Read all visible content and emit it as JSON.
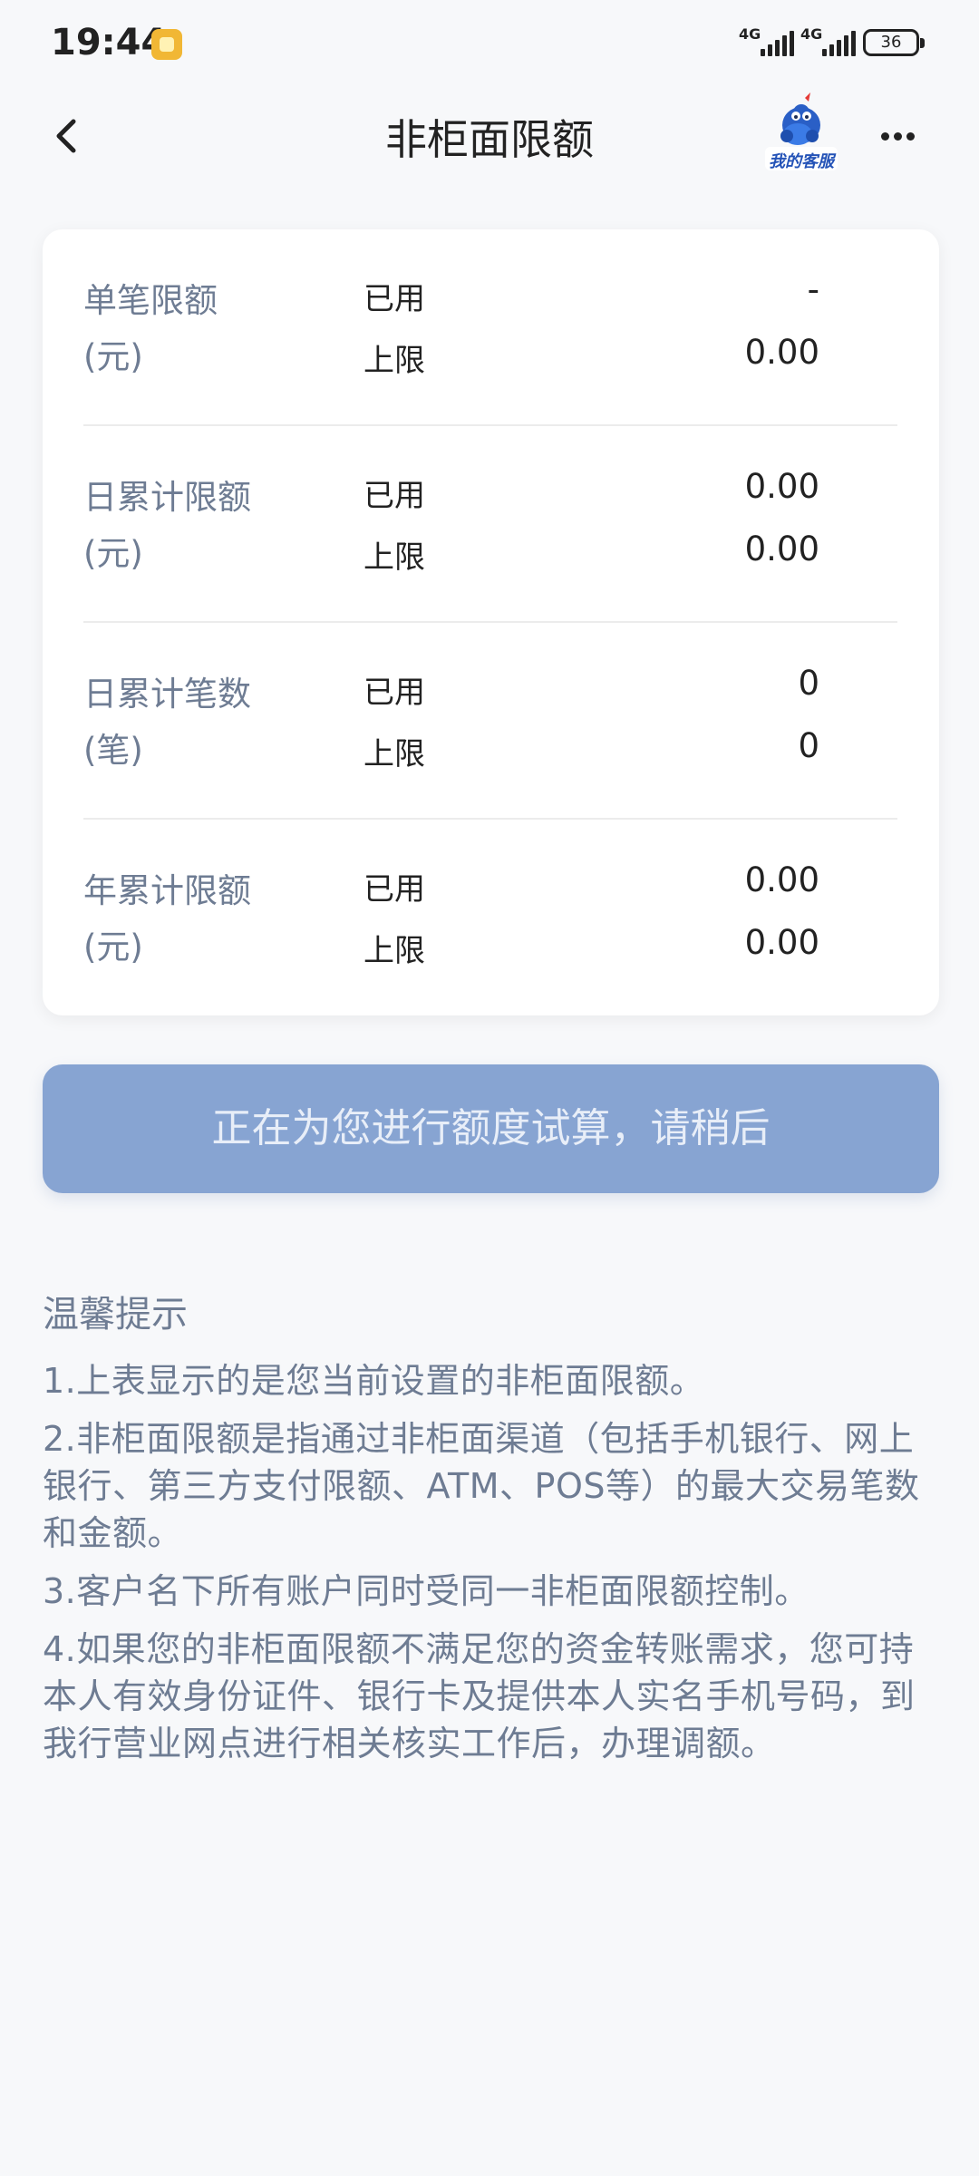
{
  "status_bar": {
    "time": "19:44",
    "signal1": "4G",
    "signal2": "4G",
    "battery": "36"
  },
  "header": {
    "title": "非柜面限额",
    "customer_service_label": "我的客服"
  },
  "limits": [
    {
      "label": "单笔限额(元)",
      "used_label": "已用",
      "used_value": "-",
      "limit_label": "上限",
      "limit_value": "0.00"
    },
    {
      "label": "日累计限额(元)",
      "used_label": "已用",
      "used_value": "0.00",
      "limit_label": "上限",
      "limit_value": "0.00"
    },
    {
      "label": "日累计笔数(笔)",
      "used_label": "已用",
      "used_value": "0",
      "limit_label": "上限",
      "limit_value": "0"
    },
    {
      "label": "年累计限额(元)",
      "used_label": "已用",
      "used_value": "0.00",
      "limit_label": "上限",
      "limit_value": "0.00"
    }
  ],
  "button": {
    "label": "正在为您进行额度试算，请稍后"
  },
  "tips": {
    "title": "温馨提示",
    "items": [
      "1.上表显示的是您当前设置的非柜面限额。",
      "2.非柜面限额是指通过非柜面渠道（包括手机银行、网上银行、第三方支付限额、ATM、POS等）的最大交易笔数和金额。",
      "3.客户名下所有账户同时受同一非柜面限额控制。",
      "4.如果您的非柜面限额不满足您的资金转账需求，您可持本人有效身份证件、银行卡及提供本人实名手机号码，到我行营业网点进行相关核实工作后，办理调额。"
    ]
  },
  "colors": {
    "button_bg": "#87a4d2",
    "label_text": "#6e7c93",
    "card_bg": "#ffffff",
    "page_bg": "#f7f8fa"
  },
  "icons": {
    "back": "chevron-left-icon",
    "customer_service": "customer-service-icon",
    "more": "more-dots-icon"
  }
}
